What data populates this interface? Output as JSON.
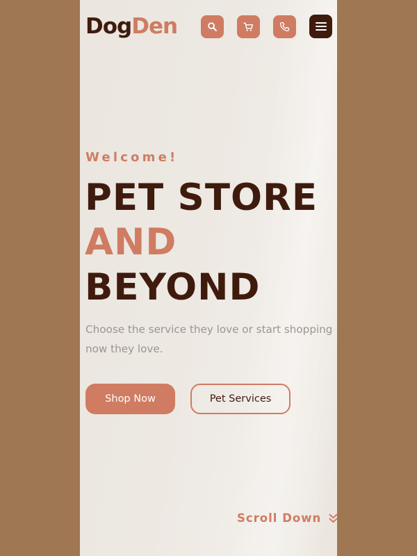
{
  "brand": {
    "name_part1": "Dog",
    "name_part2": "Den"
  },
  "header": {
    "icons": [
      "search-icon",
      "cart-icon",
      "phone-icon",
      "menu-icon"
    ]
  },
  "hero": {
    "eyebrow": "Welcome!",
    "headline_line1": "PET STORE",
    "headline_line2": "AND",
    "headline_line3": "BEYOND",
    "description": "Choose the service they love or start shopping now they love.",
    "primary_button": "Shop Now",
    "secondary_button": "Pet Services",
    "scroll_label": "Scroll Down"
  },
  "colors": {
    "outer_background": "#a07753",
    "page_background": "#ede8e2",
    "accent": "#cf7c62",
    "dark_brown": "#3f1b0e",
    "muted_text": "#9a9591"
  }
}
